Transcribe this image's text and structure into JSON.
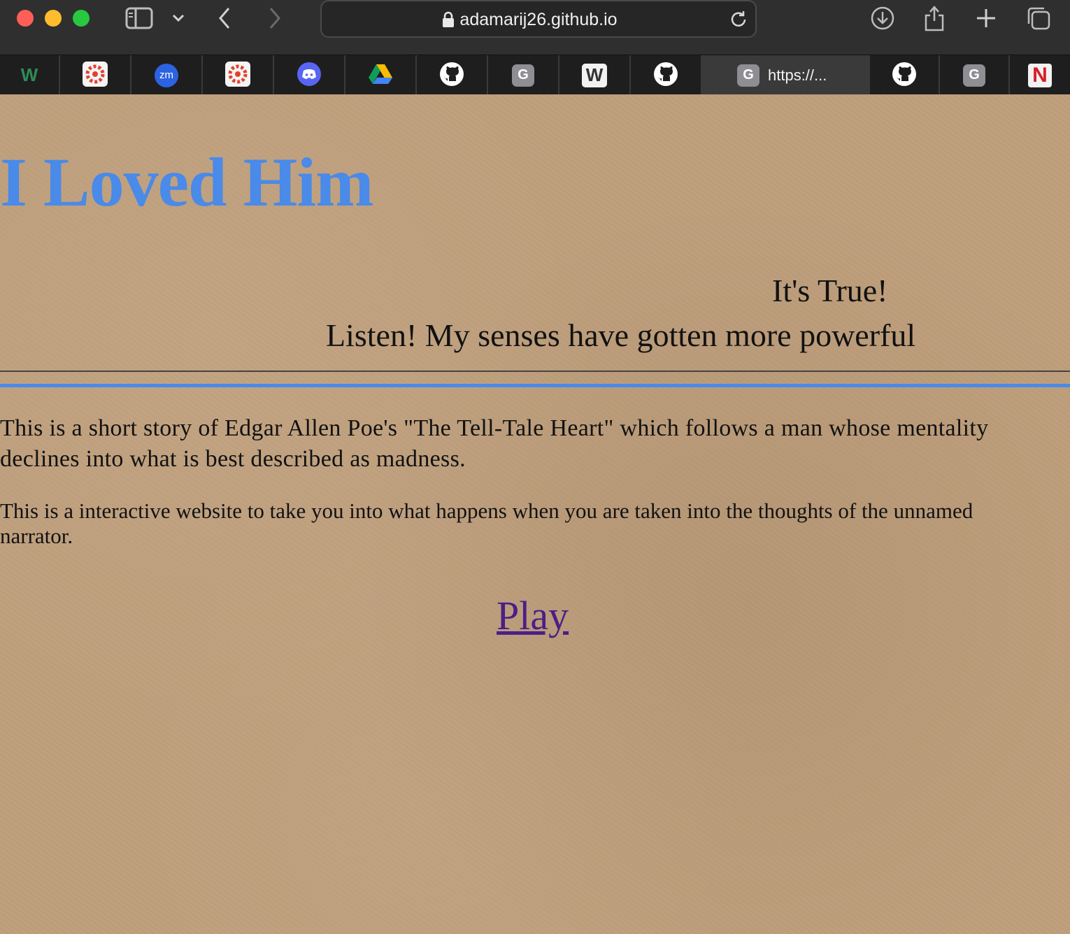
{
  "browser": {
    "address_url": "adamarij26.github.io",
    "active_tab_label": "https://...",
    "favorites": [
      {
        "name": "w3schools",
        "glyph": "W"
      },
      {
        "name": "canvas",
        "glyph": ""
      },
      {
        "name": "zoom",
        "glyph": "zm"
      },
      {
        "name": "canvas",
        "glyph": ""
      },
      {
        "name": "discord",
        "glyph": ""
      },
      {
        "name": "google-drive",
        "glyph": ""
      },
      {
        "name": "github",
        "glyph": ""
      },
      {
        "name": "generic",
        "glyph": "G"
      },
      {
        "name": "weebly",
        "glyph": "W"
      },
      {
        "name": "github",
        "glyph": ""
      },
      {
        "name": "github",
        "glyph": ""
      },
      {
        "name": "generic",
        "glyph": "G"
      },
      {
        "name": "netflix",
        "glyph": "N"
      }
    ],
    "active_tab_glyph": "G",
    "colors": {
      "toolbar": "#2f2f2f",
      "tabbar": "#1e1e1e",
      "active_tab": "#3a3a3a"
    }
  },
  "page": {
    "headline": "I Loved Him",
    "subheading_1": "It's True!",
    "subheading_2": "Listen! My senses have gotten more powerful",
    "paragraph_1": "This is a short story of Edgar Allen Poe's \"The Tell-Tale Heart\" which follows a man whose mentality declines into what is best described as madness.",
    "paragraph_2": "This is a interactive website to take you into what happens when you are taken into the thoughts of the unnamed narrator.",
    "play_link": "Play",
    "colors": {
      "background": "#bf9f7c",
      "headline": "#4a8ae8",
      "rule_accent": "#4a8ae8",
      "link_visited": "#4b1f86"
    }
  }
}
